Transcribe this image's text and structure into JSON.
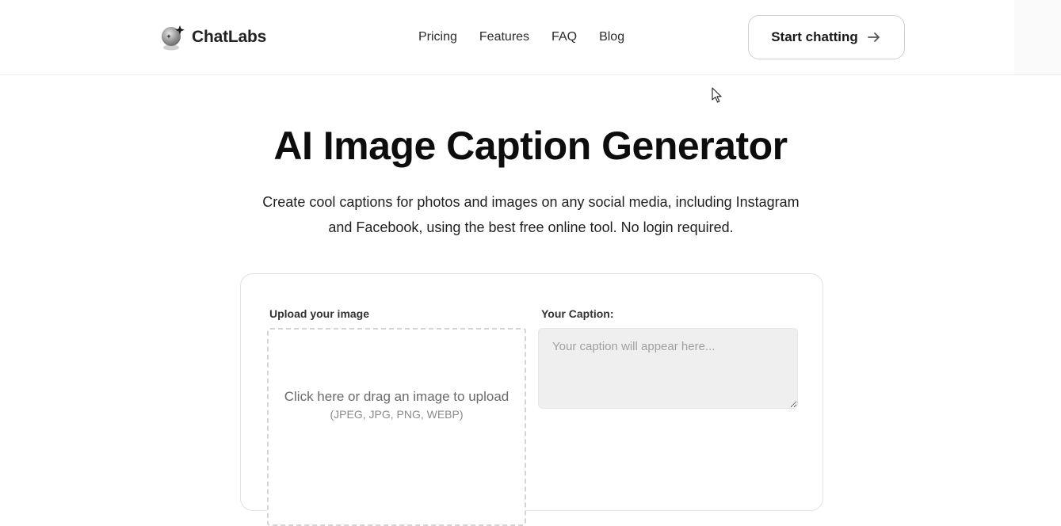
{
  "brand": {
    "name": "ChatLabs",
    "logo_icon": "globe-sparkle-icon"
  },
  "nav": {
    "items": [
      {
        "label": "Pricing"
      },
      {
        "label": "Features"
      },
      {
        "label": "FAQ"
      },
      {
        "label": "Blog"
      }
    ]
  },
  "cta": {
    "label": "Start chatting",
    "icon": "arrow-right-icon"
  },
  "hero": {
    "title": "AI Image Caption Generator",
    "subtitle": "Create cool captions for photos and images on any social media, including Instagram and Facebook, using the best free online tool. No login required."
  },
  "tool": {
    "upload_label": "Upload your image",
    "upload_prompt": "Click here or drag an image to upload",
    "upload_formats": "(JPEG, JPG, PNG, WEBP)",
    "caption_label": "Your Caption:",
    "caption_placeholder": "Your caption will appear here...",
    "caption_value": ""
  }
}
